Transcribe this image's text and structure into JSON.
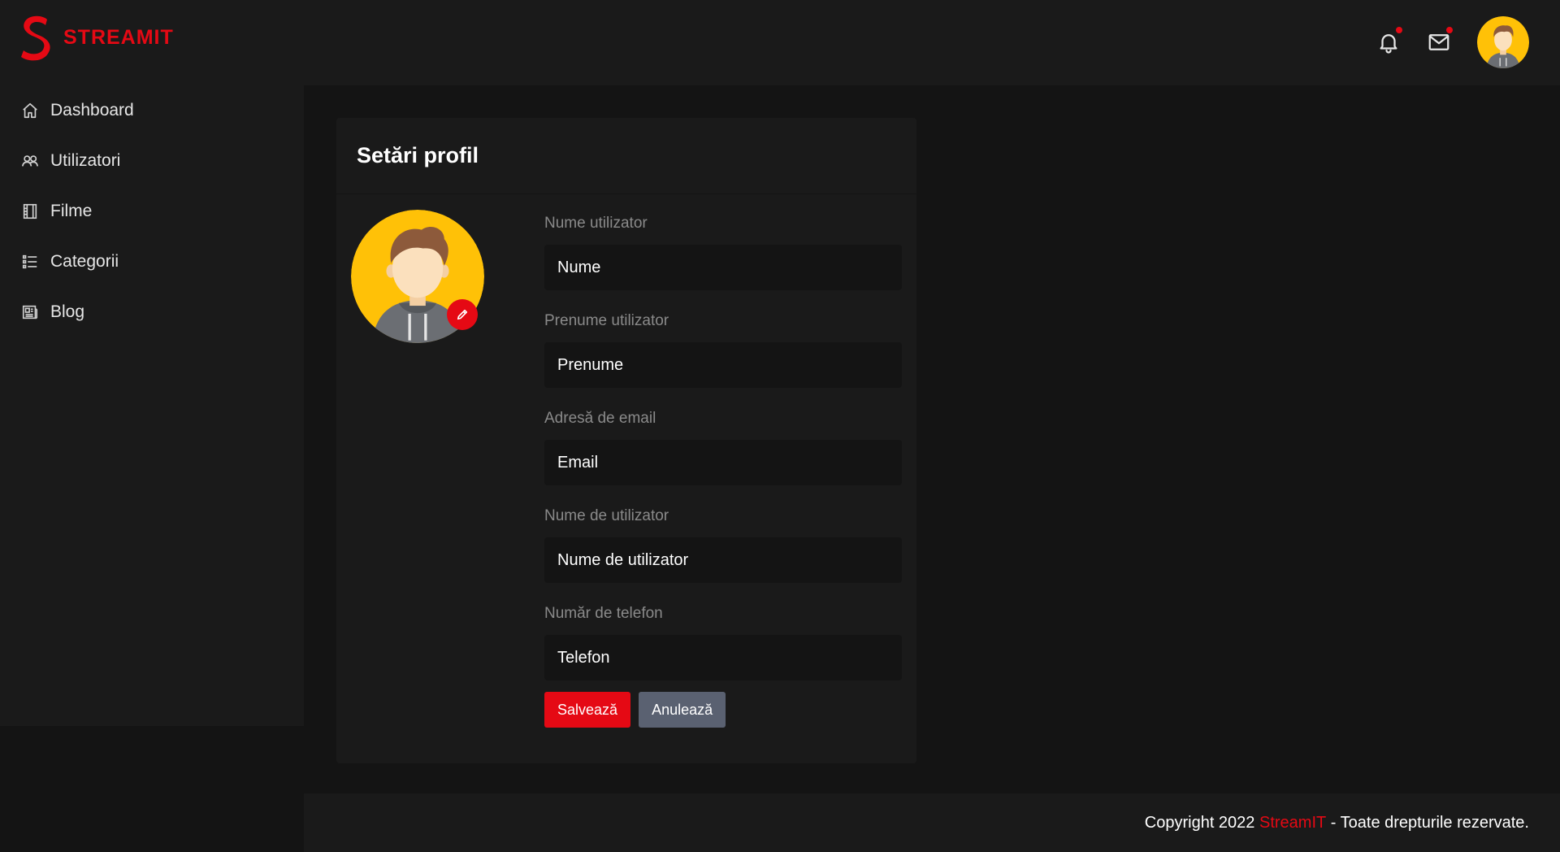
{
  "brand": {
    "name": "STREAMIT",
    "color": "#e50914"
  },
  "header": {
    "icons": [
      "bell-icon",
      "mail-icon"
    ],
    "avatar": "user-avatar"
  },
  "sidebar": {
    "items": [
      {
        "label": "Dashboard",
        "icon": "home-icon"
      },
      {
        "label": "Utilizatori",
        "icon": "users-icon"
      },
      {
        "label": "Filme",
        "icon": "film-icon"
      },
      {
        "label": "Categorii",
        "icon": "list-icon"
      },
      {
        "label": "Blog",
        "icon": "newspaper-icon"
      }
    ]
  },
  "profile": {
    "title": "Setări profil",
    "fields": [
      {
        "label": "Nume utilizator",
        "value": "Nume"
      },
      {
        "label": "Prenume utilizator",
        "value": "Prenume"
      },
      {
        "label": "Adresă de email",
        "value": "Email"
      },
      {
        "label": "Nume de utilizator",
        "value": "Nume de utilizator"
      },
      {
        "label": "Număr de telefon",
        "value": "Telefon"
      }
    ],
    "save_label": "Salvează",
    "cancel_label": "Anulează"
  },
  "footer": {
    "prefix": "Copyright 2022 ",
    "brand": "StreamIT",
    "suffix": " - Toate drepturile rezervate."
  },
  "colors": {
    "accent": "#e50914",
    "background": "#141414",
    "panel": "#1a1a1a",
    "cancel": "#5a6171"
  }
}
